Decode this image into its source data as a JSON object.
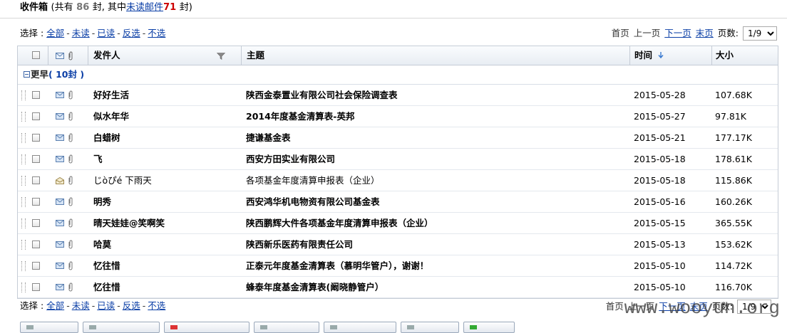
{
  "header": {
    "title": "收件箱",
    "total_prefix": "(共有",
    "total_count": "86",
    "total_suffix": "封, 其中",
    "unread_label": "未读邮件",
    "unread_count": "71",
    "unread_suffix": "封)"
  },
  "selection": {
    "label": "选择 :",
    "options": [
      "全部",
      "未读",
      "已读",
      "反选",
      "不选"
    ]
  },
  "pager": {
    "first": "首页",
    "prev": "上一页",
    "next": "下一页",
    "last": "末页",
    "pages_label": "页数:",
    "current_page": "1/9"
  },
  "columns": {
    "sender": "发件人",
    "subject": "主题",
    "time": "时间",
    "size": "大小"
  },
  "group": {
    "label": "更早",
    "count_text": "( 10封 )"
  },
  "emails": [
    {
      "sender": "好好生活",
      "subject": "陕西金泰置业有限公司社会保险调查表",
      "time": "2015-05-28",
      "size": "107.68K",
      "read": false
    },
    {
      "sender": "似水年华",
      "subject": "2014年度基金清算表-英邦",
      "time": "2015-05-27",
      "size": "97.81K",
      "read": false
    },
    {
      "sender": "白蜡树",
      "subject": "捷谦基金表",
      "time": "2015-05-21",
      "size": "177.17K",
      "read": false
    },
    {
      "sender": "飞",
      "subject": "西安方田实业有限公司",
      "time": "2015-05-18",
      "size": "178.61K",
      "read": false
    },
    {
      "sender": "じòぴé 下雨天",
      "subject": "各项基金年度清算申报表（企业）",
      "time": "2015-05-18",
      "size": "115.86K",
      "read": true
    },
    {
      "sender": "明秀",
      "subject": "西安鸿华机电物资有限公司基金表",
      "time": "2015-05-16",
      "size": "160.26K",
      "read": false
    },
    {
      "sender": "晴天娃娃@笑啊笑",
      "subject": "陕西鹏辉大件各项基金年度清算申报表（企业）",
      "time": "2015-05-15",
      "size": "365.55K",
      "read": false
    },
    {
      "sender": "哈莫",
      "subject": "陕西新乐医药有限责任公司",
      "time": "2015-05-13",
      "size": "153.62K",
      "read": false
    },
    {
      "sender": "忆往惜",
      "subject": "正泰元年度基金清算表（慕明华管户），谢谢！",
      "time": "2015-05-10",
      "size": "114.72K",
      "read": false
    },
    {
      "sender": "忆往惜",
      "subject": "蜂泰年度基金清算表(阚晓静管户）",
      "time": "2015-05-10",
      "size": "116.70K",
      "read": false
    }
  ],
  "watermark": "www.wooyun.org",
  "colors": {
    "link": "#0a3ea6",
    "unread_count": "#cc0000",
    "total_count": "#777777",
    "table_border": "#c5ccd6"
  }
}
